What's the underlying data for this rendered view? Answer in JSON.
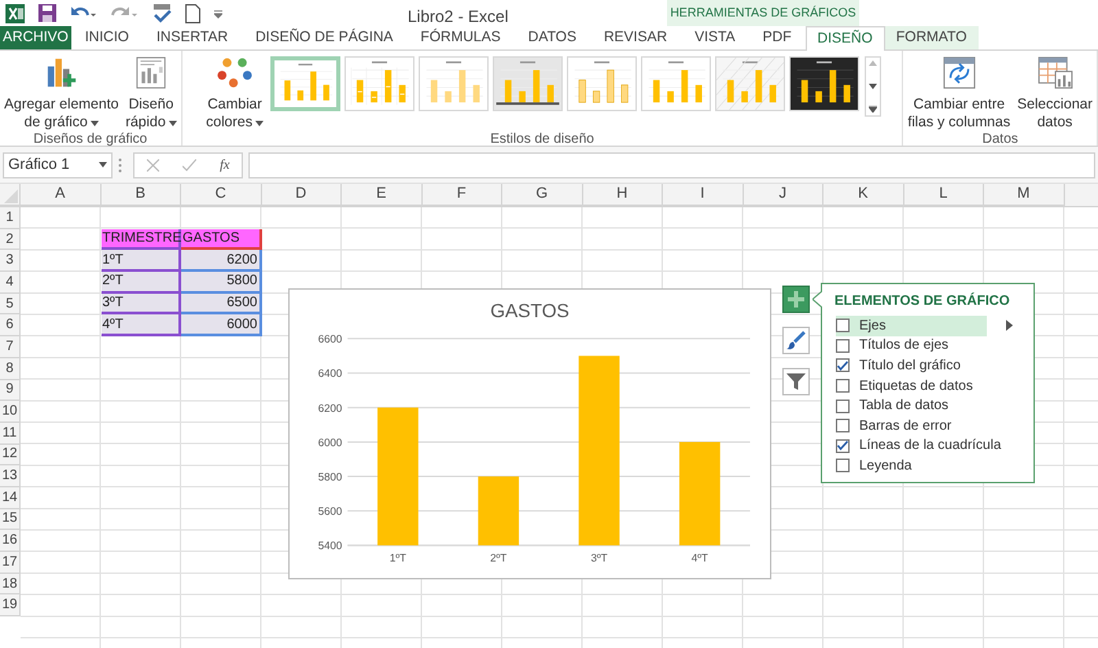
{
  "window": {
    "title": "Libro2 - Excel"
  },
  "context_group": {
    "label": "HERRAMIENTAS DE GRÁFICOS"
  },
  "tabs": [
    {
      "label": "ARCHIVO",
      "kind": "file",
      "selected": false
    },
    {
      "label": "INICIO",
      "kind": "normal",
      "selected": false
    },
    {
      "label": "INSERTAR",
      "kind": "normal",
      "selected": false
    },
    {
      "label": "DISEÑO DE PÁGINA",
      "kind": "normal",
      "selected": false
    },
    {
      "label": "FÓRMULAS",
      "kind": "normal",
      "selected": false
    },
    {
      "label": "DATOS",
      "kind": "normal",
      "selected": false
    },
    {
      "label": "REVISAR",
      "kind": "normal",
      "selected": false
    },
    {
      "label": "VISTA",
      "kind": "normal",
      "selected": false
    },
    {
      "label": "PDF",
      "kind": "normal",
      "selected": false
    },
    {
      "label": "DISEÑO",
      "kind": "context",
      "selected": true
    },
    {
      "label": "FORMATO",
      "kind": "context",
      "selected": false
    }
  ],
  "ribbon": {
    "groups": [
      {
        "label": "Diseños de gráfico",
        "buttons": [
          {
            "lines": [
              "Agregar elemento",
              "de gráfico"
            ],
            "dropdown": true
          },
          {
            "lines": [
              "Diseño",
              "rápido"
            ],
            "dropdown": true
          }
        ]
      },
      {
        "label": "Estilos de diseño",
        "buttons": [
          {
            "lines": [
              "Cambiar",
              "colores"
            ],
            "dropdown": true
          }
        ],
        "styles": [
          {
            "kind": "plain",
            "selected": true
          },
          {
            "kind": "labels",
            "selected": false
          },
          {
            "kind": "pale",
            "selected": false
          },
          {
            "kind": "gray",
            "selected": false
          },
          {
            "kind": "outline",
            "selected": false
          },
          {
            "kind": "plain",
            "selected": false
          },
          {
            "kind": "hatched",
            "selected": false
          },
          {
            "kind": "dark",
            "selected": false
          }
        ]
      },
      {
        "label": "Datos",
        "buttons": [
          {
            "lines": [
              "Cambiar entre",
              "filas y columnas"
            ],
            "dropdown": false
          },
          {
            "lines": [
              "Seleccionar",
              "datos"
            ],
            "dropdown": false
          }
        ]
      }
    ]
  },
  "formula_bar": {
    "name_box": "Gráfico 1",
    "function_label": "fx"
  },
  "sheet": {
    "columns": [
      "A",
      "B",
      "C",
      "D",
      "E",
      "F",
      "G",
      "H",
      "I",
      "J",
      "K",
      "L",
      "M"
    ],
    "rows": [
      "1",
      "2",
      "3",
      "4",
      "5",
      "6",
      "7",
      "8",
      "9",
      "10",
      "11",
      "12",
      "13",
      "14",
      "15",
      "16",
      "17",
      "18",
      "19"
    ],
    "table": {
      "header": [
        "TRIMESTRE",
        "GASTOS"
      ],
      "rows": [
        [
          "1ºT",
          "6200"
        ],
        [
          "2ºT",
          "5800"
        ],
        [
          "3ºT",
          "6500"
        ],
        [
          "4ºT",
          "6000"
        ]
      ]
    }
  },
  "chart": {
    "chart_data": {
      "type": "bar",
      "title": "GASTOS",
      "categories": [
        "1ºT",
        "2ºT",
        "3ºT",
        "4ºT"
      ],
      "series": [
        {
          "color": "#ffc000",
          "values": [
            6200,
            5800,
            6500,
            6000
          ]
        }
      ],
      "ylim": [
        5400,
        6600
      ],
      "yticks": [
        5400,
        5600,
        5800,
        6000,
        6200,
        6400,
        6600
      ],
      "grid": true
    }
  },
  "chart_tools": [
    {
      "selected": true
    },
    {
      "selected": false
    },
    {
      "selected": false
    }
  ],
  "elements_panel": {
    "title": "ELEMENTOS DE GRÁFICO",
    "items": [
      {
        "label": "Ejes",
        "checked": false,
        "selected": true,
        "submenu": true
      },
      {
        "label": "Títulos de ejes",
        "checked": false,
        "selected": false,
        "submenu": false
      },
      {
        "label": "Título del gráfico",
        "checked": true,
        "selected": false,
        "submenu": false
      },
      {
        "label": "Etiquetas de datos",
        "checked": false,
        "selected": false,
        "submenu": false
      },
      {
        "label": "Tabla de datos",
        "checked": false,
        "selected": false,
        "submenu": false
      },
      {
        "label": "Barras de error",
        "checked": false,
        "selected": false,
        "submenu": false
      },
      {
        "label": "Líneas de la cuadrícula",
        "checked": true,
        "selected": false,
        "submenu": false
      },
      {
        "label": "Leyenda",
        "checked": false,
        "selected": false,
        "submenu": false
      }
    ]
  }
}
